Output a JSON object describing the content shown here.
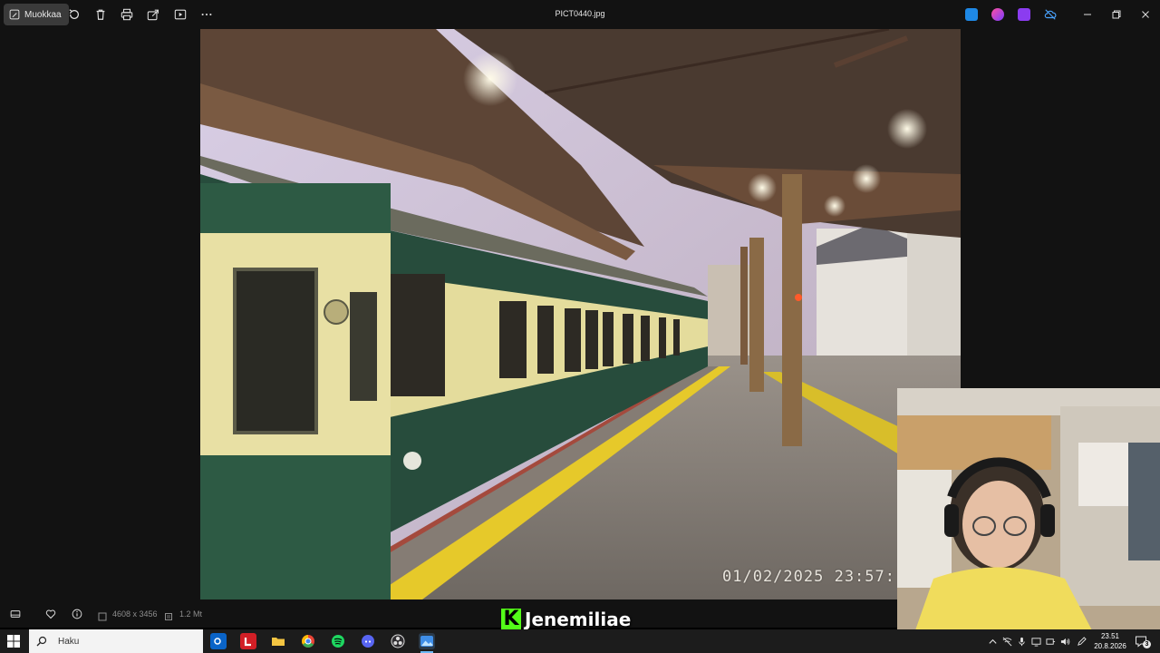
{
  "toolbar": {
    "edit_label": "Muokkaa",
    "icons": [
      "edit-icon",
      "rotate-icon",
      "delete-icon",
      "print-icon",
      "share-icon",
      "slideshow-icon",
      "more-icon"
    ]
  },
  "window": {
    "title": "PICT0440.jpg"
  },
  "photo": {
    "timestamp": "01/02/2025  23:57:"
  },
  "infobar": {
    "dimensions": "4608 x 3456",
    "filesize": "1.2 Mt"
  },
  "stream": {
    "channel_name": "Jenemiliae",
    "logo_letter": "K"
  },
  "taskbar": {
    "search_placeholder": "Haku",
    "clock_time": "23.51",
    "clock_date": "20.8.2026",
    "notification_count": "3",
    "apps": [
      "outlook",
      "l-app",
      "file-explorer",
      "chrome",
      "spotify",
      "discord",
      "obs",
      "photos"
    ]
  },
  "colors": {
    "accent": "#6cb8f5",
    "kick_green": "#53fc18",
    "window_bg": "#121212",
    "taskbar_bg": "#1c1c1c"
  }
}
